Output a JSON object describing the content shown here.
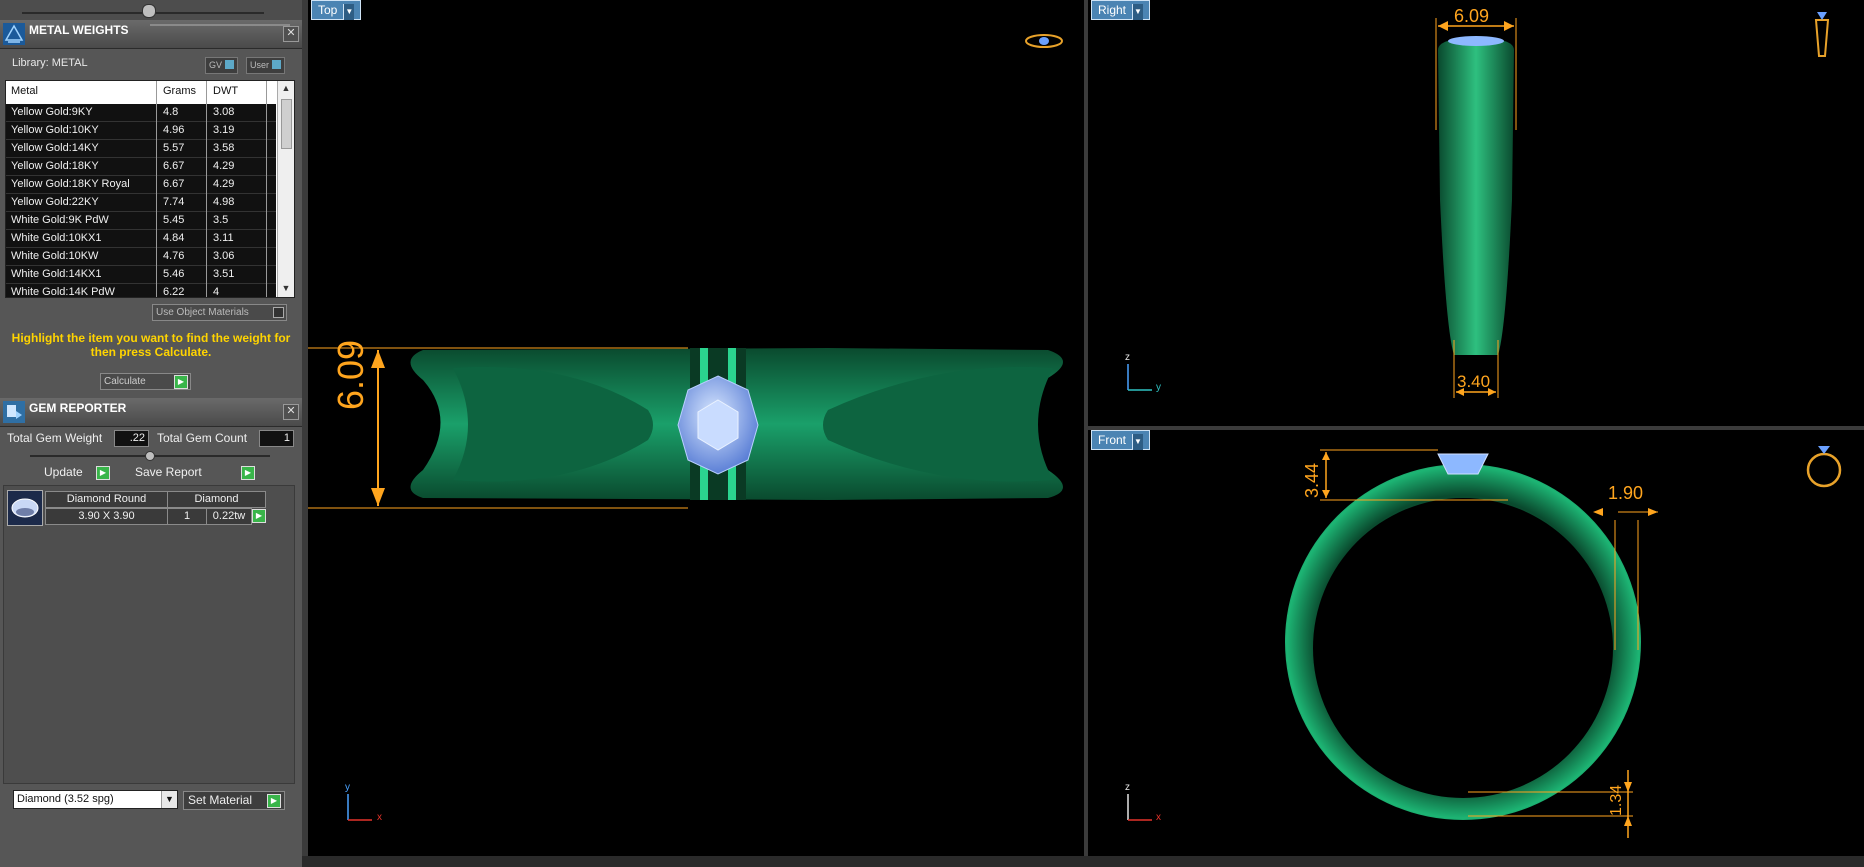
{
  "metal_panel": {
    "title": "METAL WEIGHTS",
    "library_label": "Library: METAL",
    "gv_label": "GV",
    "user_label": "User",
    "columns": [
      "Metal",
      "Grams",
      "DWT"
    ],
    "rows": [
      [
        "Yellow Gold:9KY",
        "4.8",
        "3.08"
      ],
      [
        "Yellow Gold:10KY",
        "4.96",
        "3.19"
      ],
      [
        "Yellow Gold:14KY",
        "5.57",
        "3.58"
      ],
      [
        "Yellow Gold:18KY",
        "6.67",
        "4.29"
      ],
      [
        "Yellow Gold:18KY Royal",
        "6.67",
        "4.29"
      ],
      [
        "Yellow Gold:22KY",
        "7.74",
        "4.98"
      ],
      [
        "White Gold:9K PdW",
        "5.45",
        "3.5"
      ],
      [
        "White Gold:10KX1",
        "4.84",
        "3.11"
      ],
      [
        "White Gold:10KW",
        "4.76",
        "3.06"
      ],
      [
        "White Gold:14KX1",
        "5.46",
        "3.51"
      ],
      [
        "White Gold:14K PdW",
        "6.22",
        "4"
      ]
    ],
    "use_object_materials": "Use Object Materials",
    "hint": "Highlight the item you want to find the weight for then press Calculate.",
    "calculate_label": "Calculate"
  },
  "gem_panel": {
    "title": "GEM REPORTER",
    "total_weight_label": "Total Gem Weight",
    "total_weight_value": ".22",
    "total_count_label": "Total Gem Count",
    "total_count_value": "1",
    "update_label": "Update",
    "save_report_label": "Save Report",
    "gem": {
      "name": "Diamond Round",
      "material": "Diamond",
      "size": "3.90 X 3.90",
      "count": "1",
      "weight": "0.22tw"
    },
    "material_select": "Diamond    (3.52 spg)",
    "set_material_label": "Set Material"
  },
  "viewports": {
    "top": {
      "label": "Top",
      "dim": "6.09",
      "axis_v": "y",
      "axis_h": "x"
    },
    "right": {
      "label": "Right",
      "dim_top": "6.09",
      "dim_bottom": "3.40",
      "axis_v": "z",
      "axis_h": "y"
    },
    "front": {
      "label": "Front",
      "dim_left": "3.44",
      "dim_right": "1.90",
      "dim_bottom": "1.34",
      "axis_v": "z",
      "axis_h": "x"
    }
  },
  "colors": {
    "ring_green": "#0f7a4b",
    "gem_blue": "#8db8ff",
    "dimension_orange": "#ffa51e",
    "tab_blue": "#4b84b3"
  }
}
